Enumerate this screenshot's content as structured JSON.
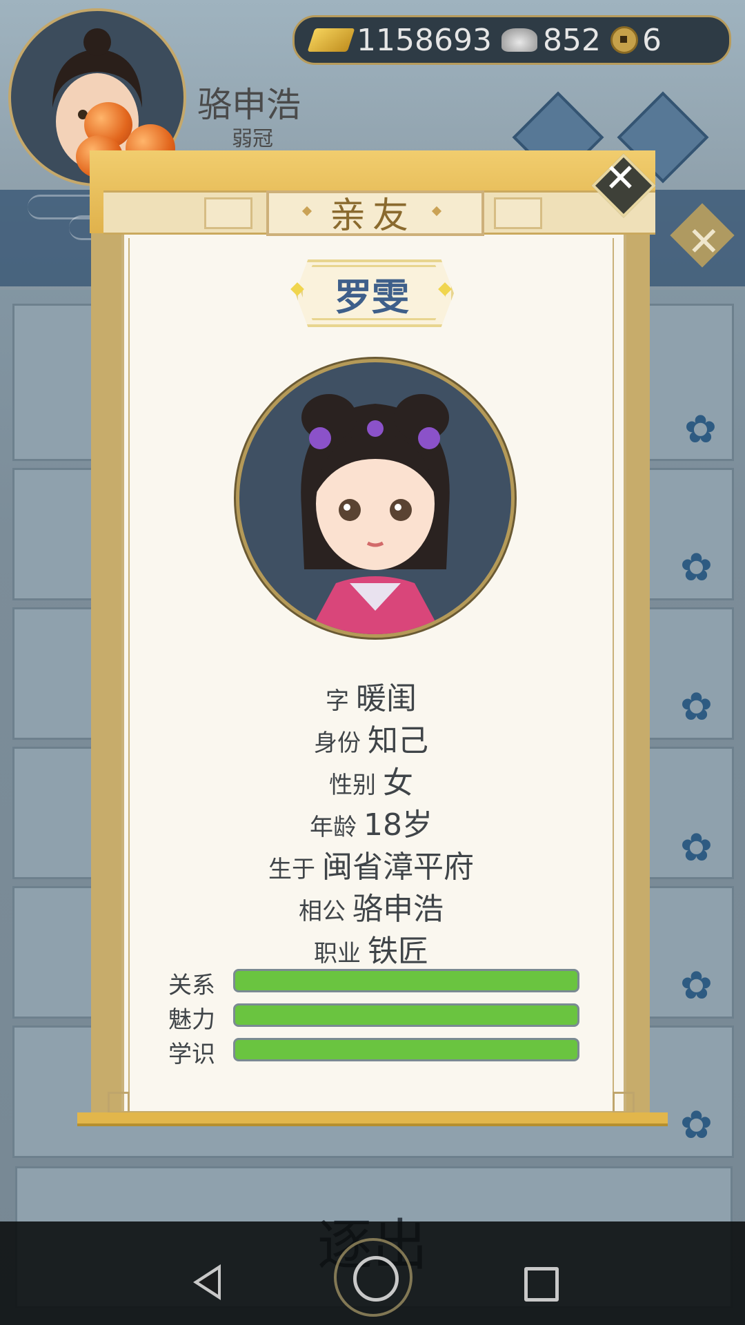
{
  "player": {
    "name": "骆申浩",
    "title": "弱冠"
  },
  "currency": {
    "gold": "1158693",
    "silver": "852",
    "coin": "6"
  },
  "panel": {
    "header": "亲友",
    "friend_name": "罗雯"
  },
  "friend": {
    "rows": [
      {
        "label": "字",
        "value": "暖闺"
      },
      {
        "label": "身份",
        "value": "知己"
      },
      {
        "label": "性别",
        "value": "女"
      },
      {
        "label": "年龄",
        "value": "18岁"
      },
      {
        "label": "生于",
        "value": "闽省漳平府"
      },
      {
        "label": "相公",
        "value": "骆申浩"
      },
      {
        "label": "职业",
        "value": "铁匠"
      }
    ],
    "stats": [
      {
        "label": "关系",
        "level": 1.0
      },
      {
        "label": "魅力",
        "level": 1.0
      },
      {
        "label": "学识",
        "level": 1.0
      }
    ]
  },
  "expel_label": "逐出",
  "icons": {
    "gold": "gold-ingot-icon",
    "silver": "silver-ingot-icon",
    "coin": "copper-coin-icon",
    "close": "close-icon",
    "back": "back-triangle-icon",
    "home": "home-circle-icon",
    "recent": "recent-apps-square-icon"
  },
  "colors": {
    "accent": "#c7ac6b",
    "bar": "#6ac440",
    "name": "#3e5f8a"
  }
}
